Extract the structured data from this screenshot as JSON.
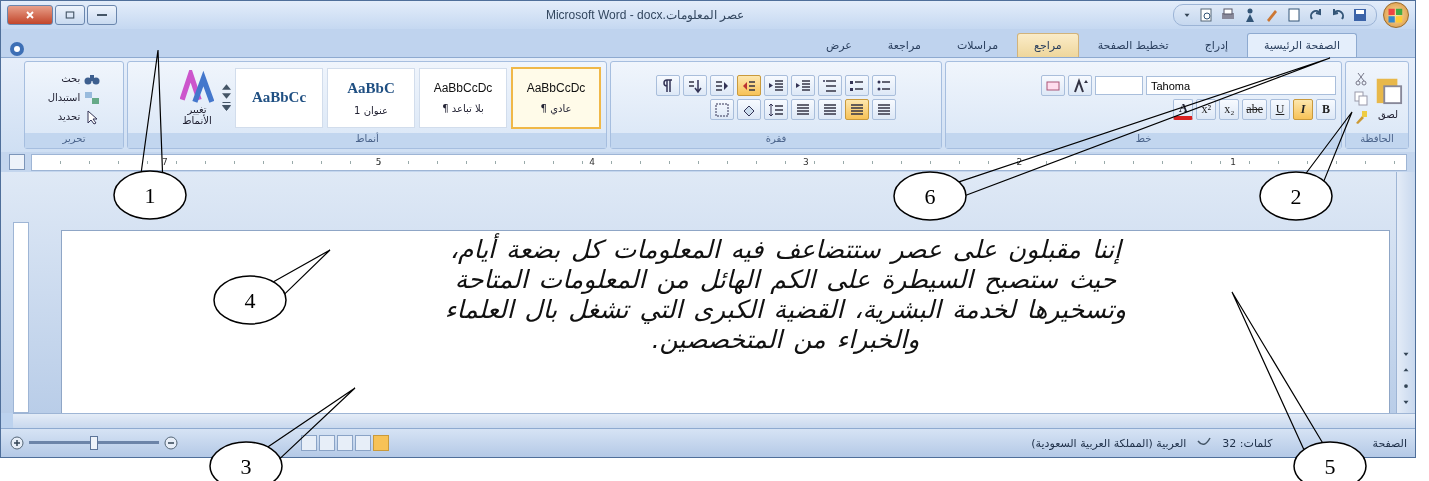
{
  "window": {
    "title": "Microsoft Word - docx.عصر المعلومات"
  },
  "tabs": [
    {
      "label": "الصفحة الرئيسية",
      "selected": true,
      "hover": false
    },
    {
      "label": "إدراج",
      "selected": false,
      "hover": false
    },
    {
      "label": "تخطيط الصفحة",
      "selected": false,
      "hover": false
    },
    {
      "label": "مراجع",
      "selected": false,
      "hover": true
    },
    {
      "label": "مراسلات",
      "selected": false,
      "hover": false
    },
    {
      "label": "مراجعة",
      "selected": false,
      "hover": false
    },
    {
      "label": "عرض",
      "selected": false,
      "hover": false
    }
  ],
  "clipboard": {
    "paste_label": "لصق",
    "group_label": "الحافظة"
  },
  "font": {
    "font_name": "Tahoma",
    "group_label": "خط",
    "buttons": [
      {
        "label": "B",
        "kind": "bold",
        "selected": false
      },
      {
        "label": "I",
        "kind": "italic",
        "selected": true
      },
      {
        "label": "U",
        "kind": "underline",
        "selected": false
      },
      {
        "label": "abe",
        "kind": "strike",
        "selected": false
      },
      {
        "label": "x₂",
        "kind": "plain",
        "selected": false
      },
      {
        "label": "x²",
        "kind": "plain",
        "selected": false
      },
      {
        "label": "A",
        "kind": "font-color",
        "selected": false
      }
    ]
  },
  "paragraph": {
    "group_label": "فقرة",
    "row_1": [
      {
        "kind": "bullets",
        "selected": false
      },
      {
        "kind": "numbering",
        "selected": false
      },
      {
        "kind": "multilevel",
        "selected": false
      },
      {
        "kind": "indent",
        "selected": false
      },
      {
        "kind": "indent",
        "selected": false
      },
      {
        "kind": "rtl",
        "selected": true
      },
      {
        "kind": "ltr",
        "selected": false
      },
      {
        "kind": "sort",
        "selected": false
      },
      {
        "kind": "pilcrow",
        "selected": false
      }
    ],
    "row_2": [
      {
        "kind": "align",
        "selected": false
      },
      {
        "kind": "align",
        "selected": true
      },
      {
        "kind": "align",
        "selected": false
      },
      {
        "kind": "align",
        "selected": false
      },
      {
        "kind": "spacing",
        "selected": false
      },
      {
        "kind": "shading",
        "selected": false
      },
      {
        "kind": "borders",
        "selected": false
      }
    ]
  },
  "styles": {
    "group_label": "أنماط",
    "items": [
      {
        "preview": "AaBbCcDc",
        "label": "¶ عادي",
        "selected": true,
        "kind": "body"
      },
      {
        "preview": "AaBbCcDc",
        "label": "¶ بلا تباعد",
        "selected": false,
        "kind": "body"
      },
      {
        "preview": "AaBbC",
        "label": "عنوان 1",
        "selected": false,
        "kind": "heading"
      },
      {
        "preview": "AaBbCc",
        "selected": false,
        "kind": "heading"
      }
    ],
    "change_styles": [
      "تغيير",
      "الأنماط"
    ]
  },
  "editing": {
    "group_label": "تحرير",
    "items": [
      {
        "label": "بحث",
        "kind": "find"
      },
      {
        "label": "استبدال",
        "kind": "replace"
      },
      {
        "label": "تحديد",
        "kind": "select"
      }
    ]
  },
  "ruler": {
    "numbers": [
      "1",
      "2",
      "3",
      "4",
      "5",
      "7"
    ]
  },
  "document": {
    "lines": [
      "إننا مقبلون على عصر ستتضاعف فيه المعلومات كل بضعة أيام،",
      "حيث ستصبح السيطرة على الكم الهائل من المعلومات المتاحة",
      "وتسخيرها لخدمة البشرية، القضية الكبرى التي تشغل بال العلماء",
      "والخبراء من المتخصصين."
    ]
  },
  "status_bar": {
    "page": "الصفحة",
    "words": "كلمات: 32",
    "language": "العربية (المملكة العربية السعودية)",
    "views": [
      {
        "selected": false
      },
      {
        "selected": false
      },
      {
        "selected": false
      },
      {
        "selected": false
      },
      {
        "selected": true
      }
    ],
    "zoom": {
      "level": 0.5
    }
  },
  "callouts": [
    {
      "number": "2"
    },
    {
      "number": "6"
    },
    {
      "number": "1"
    },
    {
      "number": "4"
    },
    {
      "number": "5"
    },
    {
      "number": "3"
    }
  ]
}
